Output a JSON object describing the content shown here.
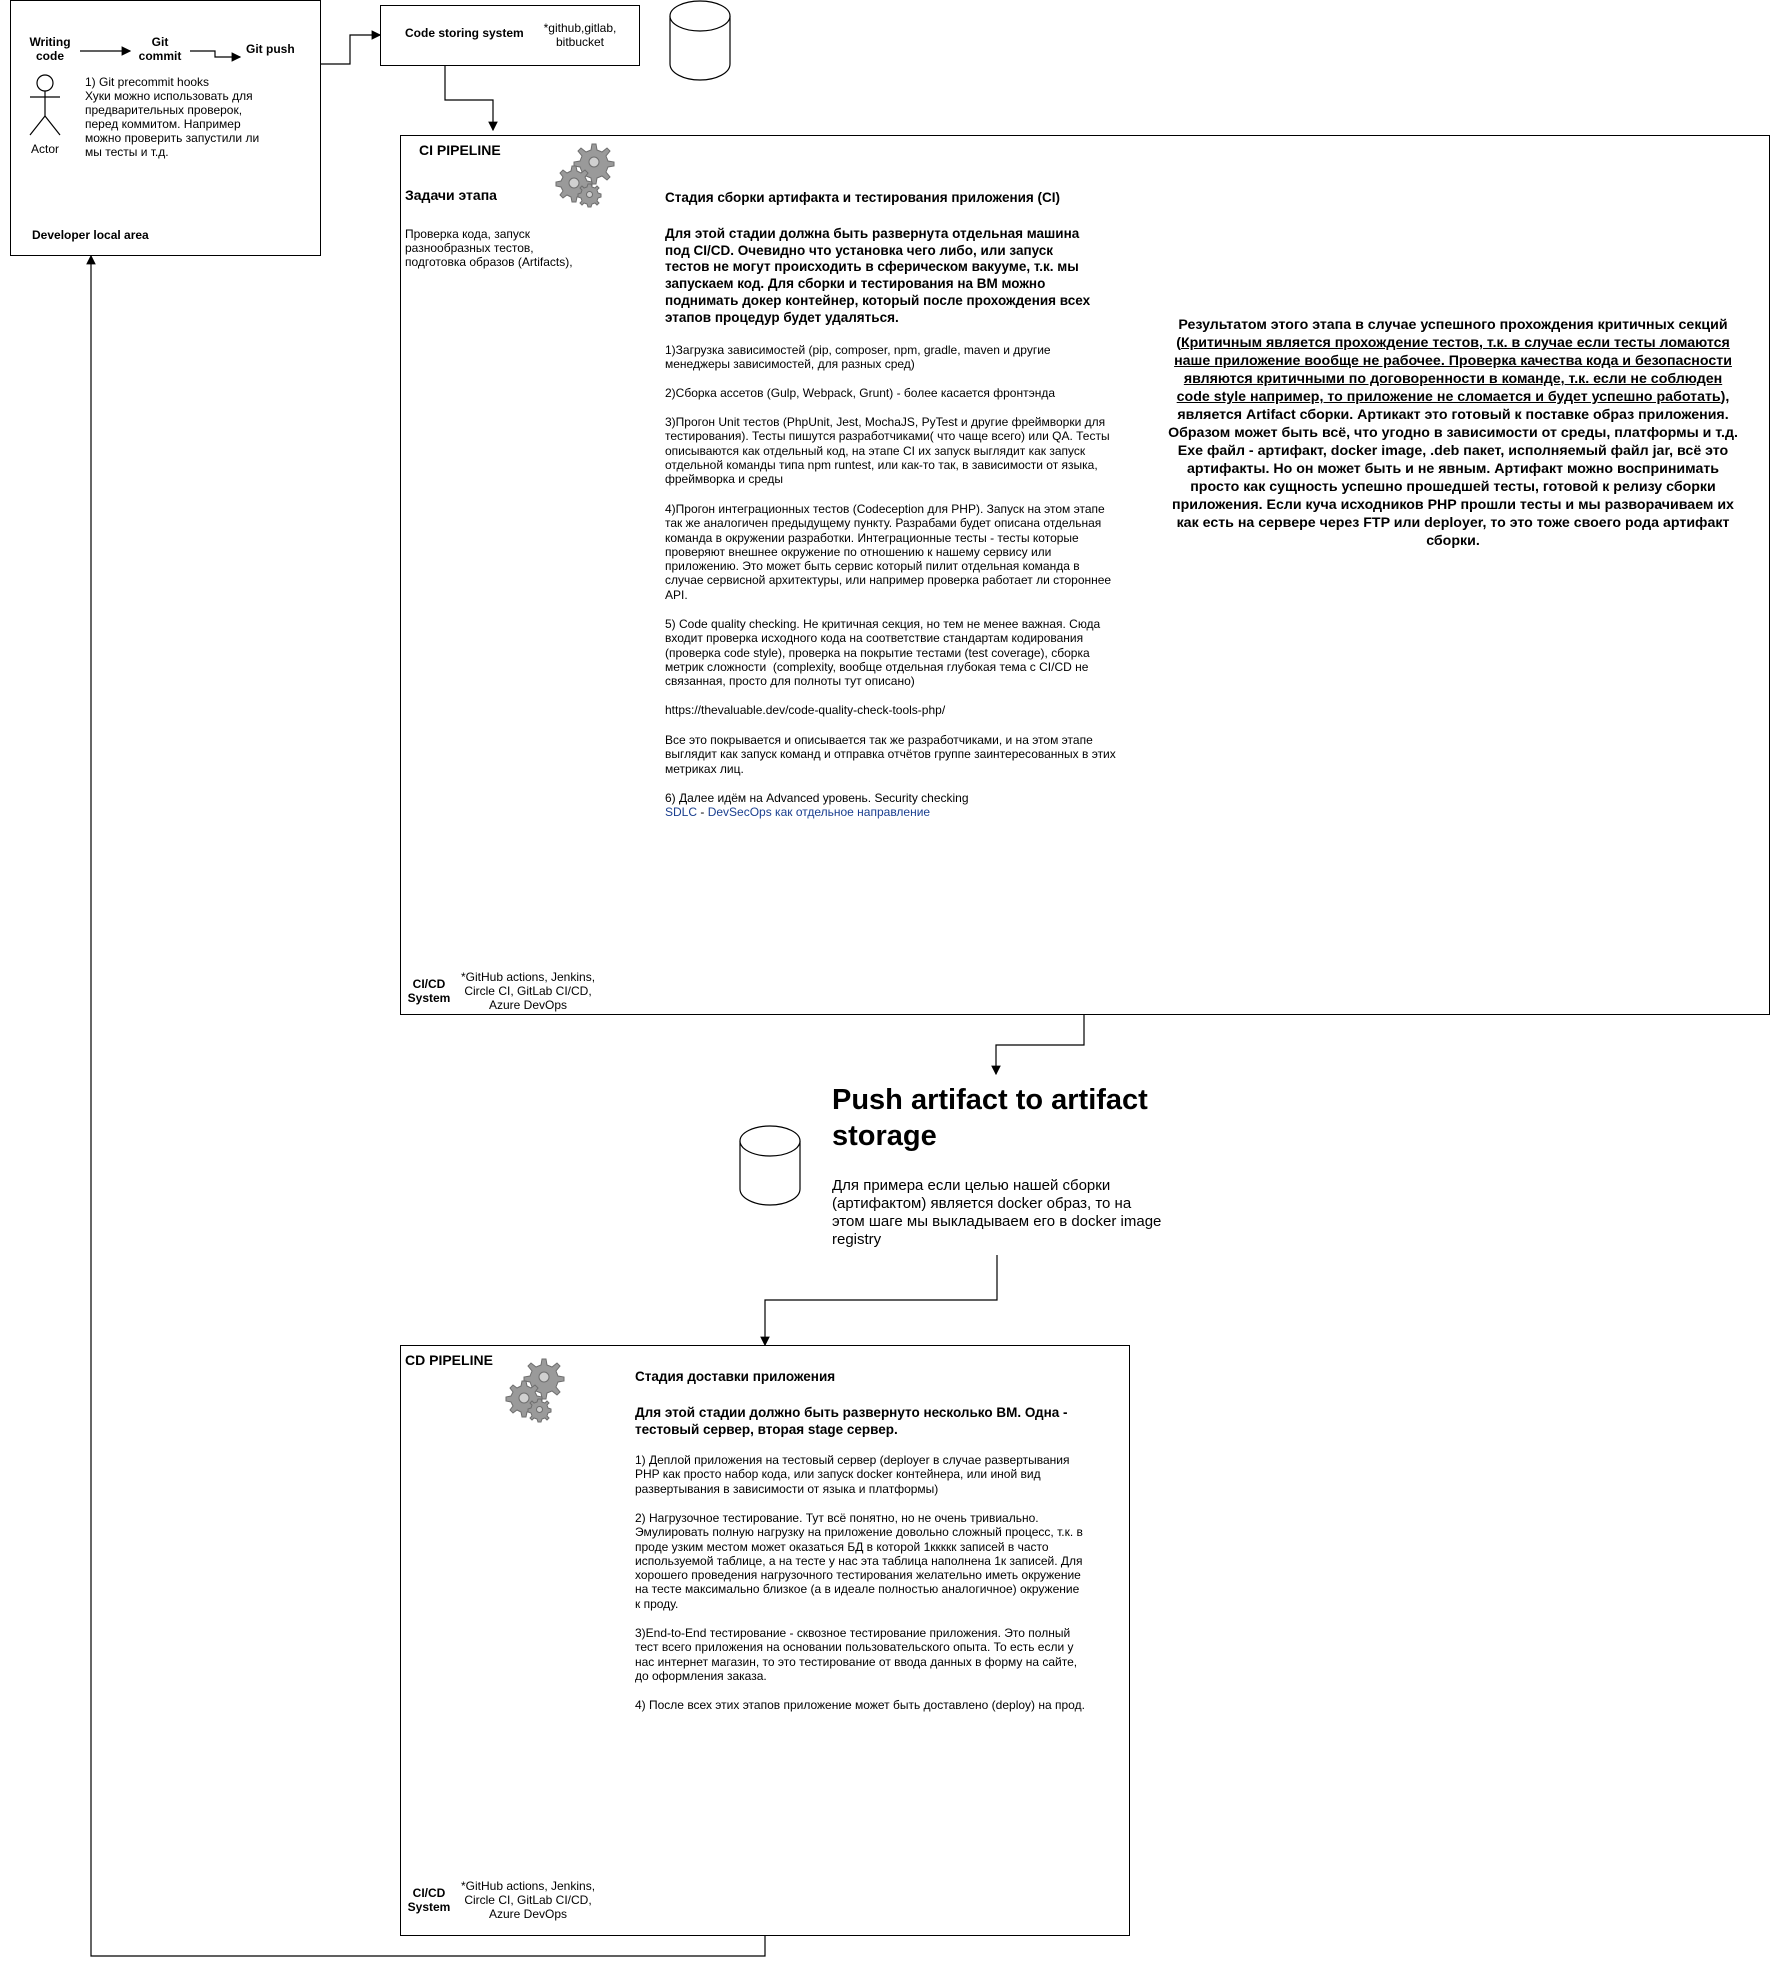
{
  "developer": {
    "writing_code": "Writing\ncode",
    "git_commit": "Git\ncommit",
    "git_push": "Git push",
    "actor_label": "Actor",
    "hooks_note": "1) Git precommit hooks\nХуки можно использовать для\nпредварительных проверок,\nперед коммитом. Например\nможно проверить запустили ли\nмы тесты и т.д.",
    "area_label": "Developer local area"
  },
  "code_storage": {
    "title": "Code storing system",
    "examples": "*github,gitlab,\nbitbucket"
  },
  "ci": {
    "title": "CI PIPELINE",
    "tasks_title": "Задачи этапа",
    "tasks_text": "Проверка кода, запуск\nразнообразных тестов,\nподготовка образов (Artifacts),",
    "stage_title": "Стадия сборки артифакта и тестирования приложения (CI)",
    "intro_bold": "Для этой стадии должна быть развернута отдельная машина\nпод CI/CD. Очевидно что установка чего либо, или запуск\nтестов не могут происходить в сферическом вакууме, т.к. мы\nзапускаем код. Для сборки и тестирования на ВМ можно\nподнимать докер контейнер, который после прохождения всех\nэтапов процедур будет удаляться.",
    "step1": "1)Загрузка зависимостей (pip, composer, npm, gradle, maven и другие\nменеджеры зависимостей, для разных сред)",
    "step2": "2)Сборка ассетов (Gulp, Webpack, Grunt) - более касается фронтэнда",
    "step3": "3)Прогон Unit тестов (PhpUnit, Jest, MochaJS, PyTest и другие фреймворки для\nтестирования). Тесты пишутся разработчиками( что чаще всего) или QA. Тесты\nописываются как отдельный код, на этапе CI их запуск выглядит как запуск\nотдельной команды типа npm runtest, или как-то так, в зависимости от языка,\nфреймворка и среды",
    "step4": "4)Прогон интеграционных тестов (Codeception для PHP). Запуск на этом этапе\nтак же аналогичен предыдущему пункту. Разрабами будет описана отдельная\nкоманда в окружении разработки. Интеграционные тесты - тесты которые\nпроверяют внешнее окружение по отношению к нашему сервису или\nприложению. Это может быть сервис который пилит отдельная команда в\nслучае сервисной архитектуры, или например проверка работает ли стороннее\nAPI.",
    "step5": "5) Code quality checking. Не критичная секция, но тем не менее важная. Сюда\nвходит проверка исходного кода на соответствие стандартам кодирования\n(проверка code style), проверка на покрытие тестами (test coverage), сборка\nметрик сложности  (complexity, вообще отдельная глубокая тема с CI/CD не\nсвязанная, просто для полноты тут описано)",
    "url": "https://thevaluable.dev/code-quality-check-tools-php/",
    "reporting": "Все это покрывается и описывается так же разработчиками, и на этом этапе\nвыглядит как запуск команд и отправка отчётов группе заинтересованных в этих\nметриках лиц.",
    "step6": "6) Далее идём на Advanced уровень. Security checking",
    "links_sdlc": "SDLC",
    "links_sep": " - ",
    "links_devsecops": "DevSecOps",
    "links_rest": " как отдельное направление",
    "result_part1": "Результатом этого этапа в случае успешного прохождения критичных секций\n(",
    "result_underlined": "Критичным является прохождение тестов, т.к. в случае если тесты ломаются\nнаше приложение вообще не рабочее. Проверка качества кода и безопасности\nявляются критичными по договоренности в команде, т.к. если не соблюден\ncode style например, то приложение не сломается и будет успешно работать",
    "result_part2": "),\nявляется Artifact сборки. Артикакт это готовый к поставке образ приложения.\nОбразом может быть всё, что угодно в зависимости от среды, платформы и т.д.\nExe файл - артифакт, docker image, .deb пакет, исполняемый файл jar, всё это\nартифакты. Но он может быть и не явным. Артифакт можно воспринимать\nпросто как сущность успешно прошедшей тесты, готовой к релизу сборки\nприложения. Если куча исходников PHP прошли тесты и мы разворачиваем их\nкак есть на сервере через FTP или deployer, то это тоже своего рода артифакт\nсборки.",
    "system_label": "CI/CD\nSystem",
    "system_examples": "*GitHub actions, Jenkins,\nCircle CI, GitLab CI/CD,\nAzure DevOps"
  },
  "artifact": {
    "title": "Push artifact to artifact\nstorage",
    "text": "Для примера если целью нашей сборки\n(артифактом) является docker образ, то на\nэтом шаге мы выкладываем его в docker image\nregistry"
  },
  "cd": {
    "title": "CD PIPELINE",
    "stage_title": "Стадия доставки приложения",
    "intro_bold": "Для этой стадии должно быть развернуто несколько ВМ. Одна -\nтестовый сервер, вторая stage сервер.",
    "step1": "1) Деплой приложения на тестовый сервер (deployer в случае развертывания\nPHP как просто набор кода, или запуск docker контейнера, или иной вид\nразвертывания в зависимости от языка и платформы)",
    "step2": "2) Нагрузочное тестирование. Тут всё понятно, но не очень тривиально.\nЭмулировать полную нагрузку на приложение довольно сложный процесс, т.к. в\nпроде узким местом может оказаться БД в которой 1ккккк записей в часто\nиспользуемой таблице, а на тесте у нас эта таблица наполнена 1к записей. Для\nхорошего проведения нагрузочного тестирования желательно иметь окружение\nна тесте максимально близкое (а в идеале полностью аналогичное) окружение\nк проду.",
    "step3": "3)End-to-End тестирование - сквозное тестирование приложения. Это полный\nтест всего приложения на основании пользовательского опыта. То есть если у\nнас интернет магазин, то это тестирование от ввода данных в форму на сайте,\nдо оформления заказа.",
    "step4": "4) После всех этих этапов приложение может быть доставлено (deploy) на прод.",
    "system_label": "CI/CD\nSystem",
    "system_examples": "*GitHub actions, Jenkins,\nCircle CI, GitLab CI/CD,\nAzure DevOps"
  },
  "icons": [
    "database-icon",
    "gears-icon",
    "actor-icon"
  ]
}
